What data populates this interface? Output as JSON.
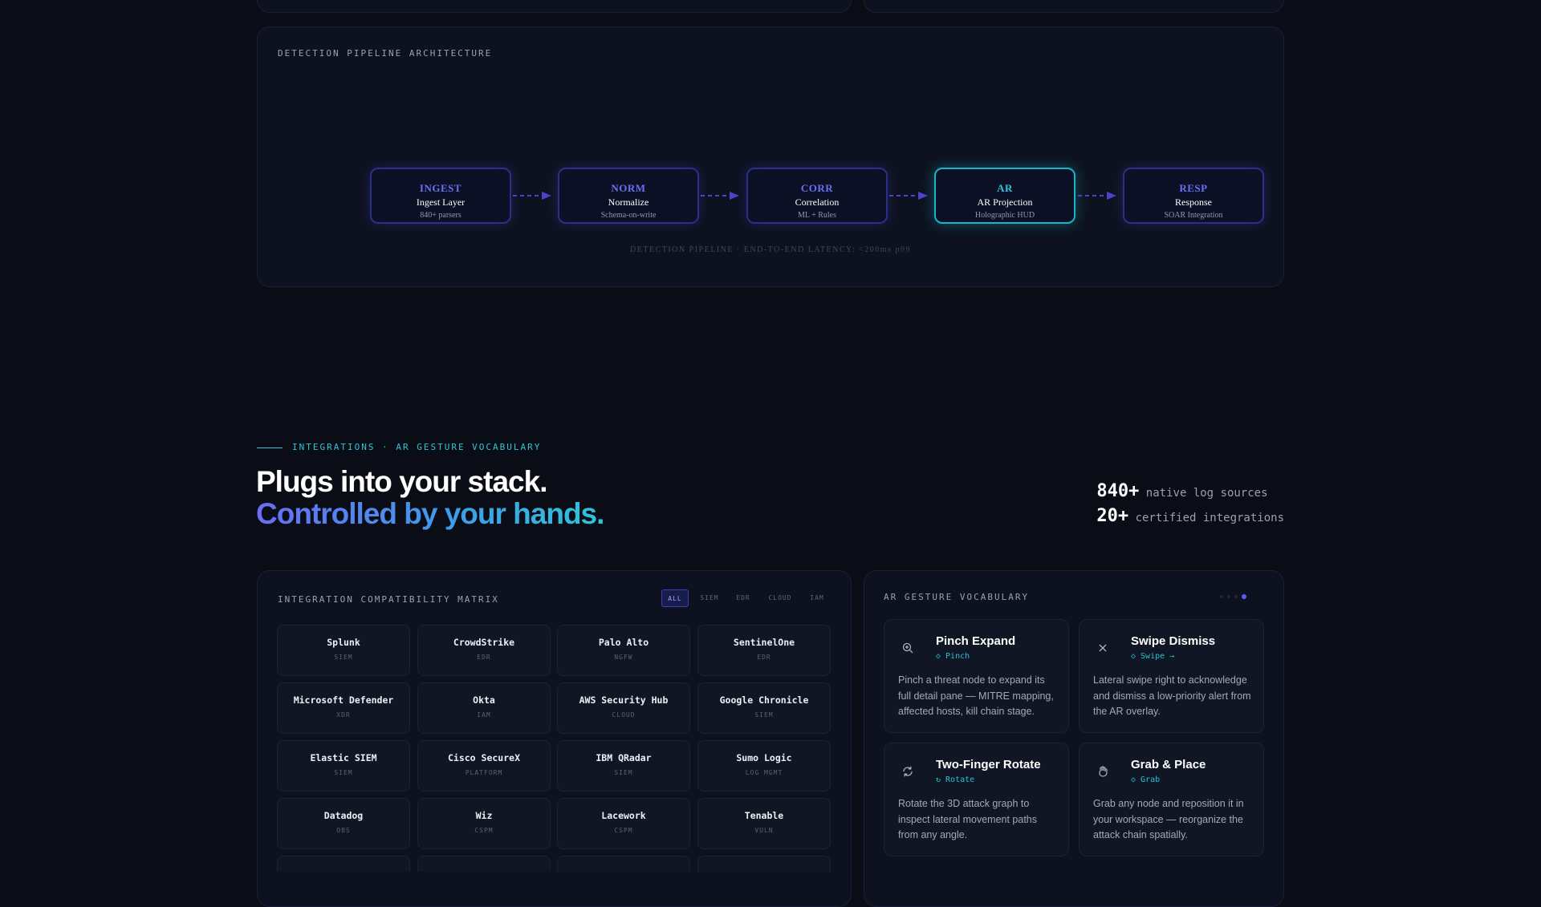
{
  "pipeline": {
    "heading": "DETECTION PIPELINE ARCHITECTURE",
    "nodes": [
      {
        "code": "INGEST",
        "name": "Ingest Layer",
        "sub": "840+ parsers",
        "active": false
      },
      {
        "code": "NORM",
        "name": "Normalize",
        "sub": "Schema-on-write",
        "active": false
      },
      {
        "code": "CORR",
        "name": "Correlation",
        "sub": "ML + Rules",
        "active": false
      },
      {
        "code": "AR",
        "name": "AR Projection",
        "sub": "Holographic HUD",
        "active": true
      },
      {
        "code": "RESP",
        "name": "Response",
        "sub": "SOAR Integration",
        "active": false
      }
    ],
    "footer": "DETECTION PIPELINE · END-TO-END LATENCY: <200ms p99"
  },
  "section": {
    "eyebrow": "INTEGRATIONS · AR GESTURE VOCABULARY",
    "title_line1": "Plugs into your stack.",
    "title_line2": "Controlled by your hands.",
    "stats": [
      {
        "value": "840+",
        "label": "native log sources"
      },
      {
        "value": "20+",
        "label": "certified integrations"
      }
    ]
  },
  "matrix": {
    "heading": "INTEGRATION COMPATIBILITY MATRIX",
    "filters": [
      "ALL",
      "SIEM",
      "EDR",
      "CLOUD",
      "IAM"
    ],
    "active_filter": "ALL",
    "tiles": [
      {
        "name": "Splunk",
        "cat": "SIEM"
      },
      {
        "name": "CrowdStrike",
        "cat": "EDR"
      },
      {
        "name": "Palo Alto",
        "cat": "NGFW"
      },
      {
        "name": "SentinelOne",
        "cat": "EDR"
      },
      {
        "name": "Microsoft Defender",
        "cat": "XDR"
      },
      {
        "name": "Okta",
        "cat": "IAM"
      },
      {
        "name": "AWS Security Hub",
        "cat": "CLOUD"
      },
      {
        "name": "Google Chronicle",
        "cat": "SIEM"
      },
      {
        "name": "Elastic SIEM",
        "cat": "SIEM"
      },
      {
        "name": "Cisco SecureX",
        "cat": "PLATFORM"
      },
      {
        "name": "IBM QRadar",
        "cat": "SIEM"
      },
      {
        "name": "Sumo Logic",
        "cat": "LOG MGMT"
      },
      {
        "name": "Datadog",
        "cat": "OBS"
      },
      {
        "name": "Wiz",
        "cat": "CSPM"
      },
      {
        "name": "Lacework",
        "cat": "CSPM"
      },
      {
        "name": "Tenable",
        "cat": "VULN"
      }
    ]
  },
  "gestures": {
    "heading": "AR GESTURE VOCABULARY",
    "cards": [
      {
        "icon": "zoom-in-icon",
        "title": "Pinch Expand",
        "tag": "◇ Pinch",
        "desc": "Pinch a threat node to expand its full detail pane — MITRE mapping, affected hosts, kill chain stage."
      },
      {
        "icon": "close-icon",
        "title": "Swipe Dismiss",
        "tag": "◇ Swipe →",
        "desc": "Lateral swipe right to acknowledge and dismiss a low-priority alert from the AR overlay."
      },
      {
        "icon": "rotate-icon",
        "title": "Two-Finger Rotate",
        "tag": "↻ Rotate",
        "desc": "Rotate the 3D attack graph to inspect lateral movement paths from any angle."
      },
      {
        "icon": "hand-icon",
        "title": "Grab & Place",
        "tag": "◇ Grab",
        "desc": "Grab any node and reposition it in your workspace — reorganize the attack chain spatially."
      }
    ]
  },
  "colors": {
    "accent_indigo": "#6a70f6",
    "accent_cyan": "#2cc6dc",
    "background": "#0a0d15"
  }
}
